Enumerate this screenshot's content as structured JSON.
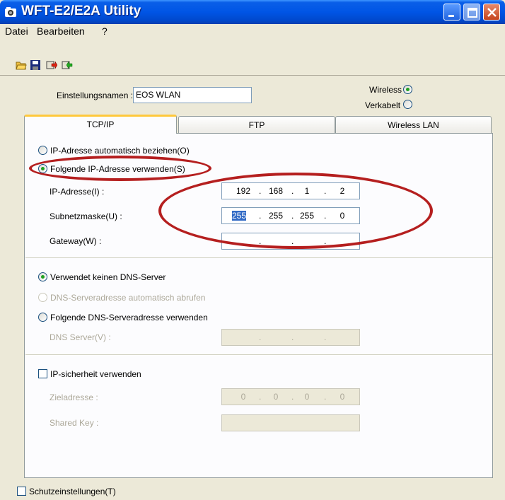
{
  "window": {
    "title": "WFT-E2/E2A Utility"
  },
  "menu": [
    "Datei",
    "Bearbeiten",
    "?"
  ],
  "toolbar": {
    "icons": [
      "open-folder-icon",
      "save-icon",
      "export-icon",
      "import-icon"
    ]
  },
  "settings": {
    "name_label": "Einstellungsnamen :",
    "name_value": "EOS WLAN",
    "wireless_label": "Wireless",
    "wired_label": "Verkabelt",
    "connection_selected": "Wireless"
  },
  "tabs": [
    {
      "label": "TCP/IP",
      "active": true
    },
    {
      "label": "FTP",
      "active": false
    },
    {
      "label": "Wireless LAN",
      "active": false
    }
  ],
  "tcpip": {
    "auto_ip_label": "IP-Adresse automatisch beziehen(O)",
    "manual_ip_label": "Folgende IP-Adresse verwenden(S)",
    "ip_label": "IP-Adresse(I) :",
    "ip": [
      "192",
      "168",
      "1",
      "2"
    ],
    "subnet_label": "Subnetzmaske(U) :",
    "subnet": [
      "255",
      "255",
      "255",
      "0"
    ],
    "gateway_label": "Gateway(W) :",
    "gateway": [
      "",
      "",
      "",
      ""
    ],
    "no_dns_label": "Verwendet keinen DNS-Server",
    "auto_dns_label": "DNS-Serveradresse automatisch abrufen",
    "manual_dns_label": "Folgende DNS-Serveradresse verwenden",
    "dns_server_label": "DNS Server(V) :",
    "dns": [
      "",
      "",
      "",
      ""
    ],
    "ipsec_label": "IP-sicherheit verwenden",
    "target_label": "Zieladresse :",
    "target": [
      "0",
      "0",
      "0",
      "0"
    ],
    "shared_key_label": "Shared Key :",
    "shared_key_value": ""
  },
  "footer": {
    "protect_label": "Schutzeinstellungen(T)"
  },
  "colors": {
    "annotation": "#B51F1F",
    "active_tab_accent": "#FFC83C",
    "radio_selected": "#21A121"
  }
}
